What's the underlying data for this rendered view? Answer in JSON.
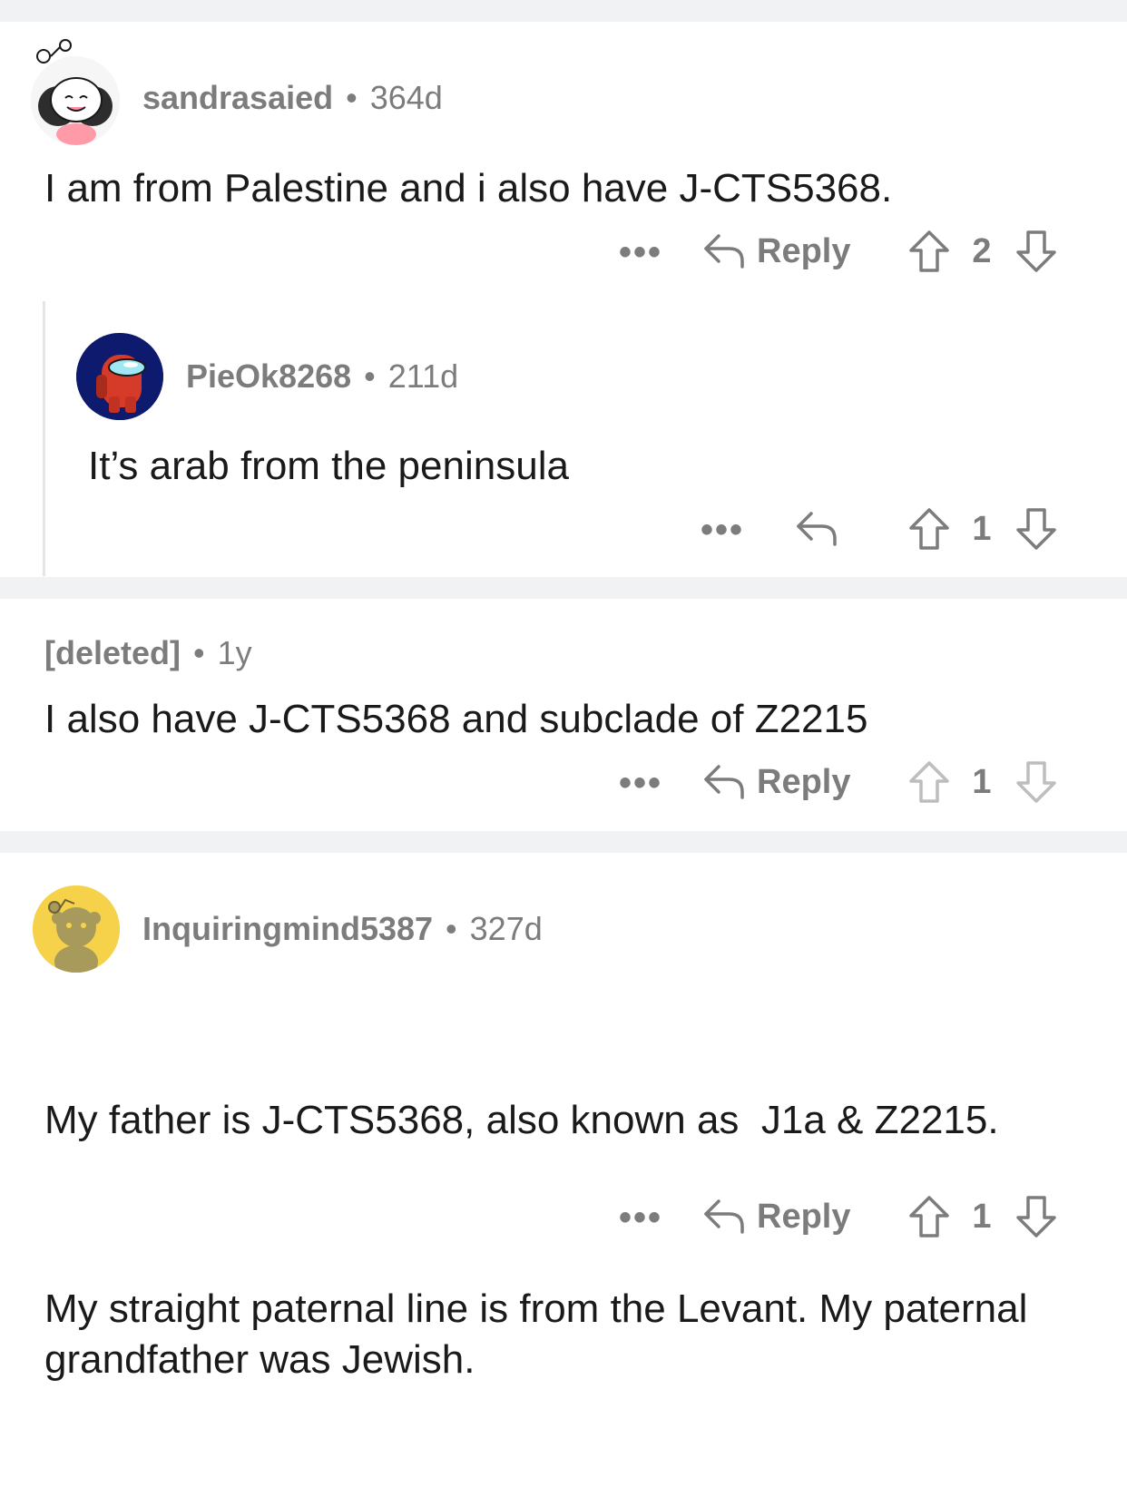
{
  "comments": [
    {
      "username": "sandrasaied",
      "separator": "•",
      "age": "364d",
      "text": "I am from Palestine and i also have J-CTS5368.",
      "more": "•••",
      "reply_label": "Reply",
      "votes": "2",
      "avatar_icon": "snoo-girl-avatar-icon"
    },
    {
      "username": "PieOk8268",
      "separator": "•",
      "age": "211d",
      "text": "It’s arab from the peninsula",
      "more": "•••",
      "reply_label": "",
      "votes": "1",
      "avatar_icon": "among-us-avatar-icon"
    },
    {
      "username": "[deleted]",
      "separator": "•",
      "age": "1y",
      "text": "I also have J-CTS5368 and subclade of Z2215",
      "more": "•••",
      "reply_label": "Reply",
      "votes": "1",
      "avatar_icon": ""
    },
    {
      "username": "Inquiringmind5387",
      "separator": "•",
      "age": "327d",
      "text_paragraphs": [
        "My father is J-CTS5368, also known as  J1a & Z2215.",
        "My straight paternal line is from the Levant. My paternal grandfather was Jewish."
      ],
      "more": "•••",
      "reply_label": "Reply",
      "votes": "1",
      "avatar_icon": "snoo-default-avatar-icon"
    }
  ],
  "colors": {
    "background": "#ffffff",
    "separator_band": "#f1f2f4",
    "meta_text": "#7c7c7c",
    "body_text": "#1a1a1b",
    "thread_line": "#e5e5e5"
  }
}
